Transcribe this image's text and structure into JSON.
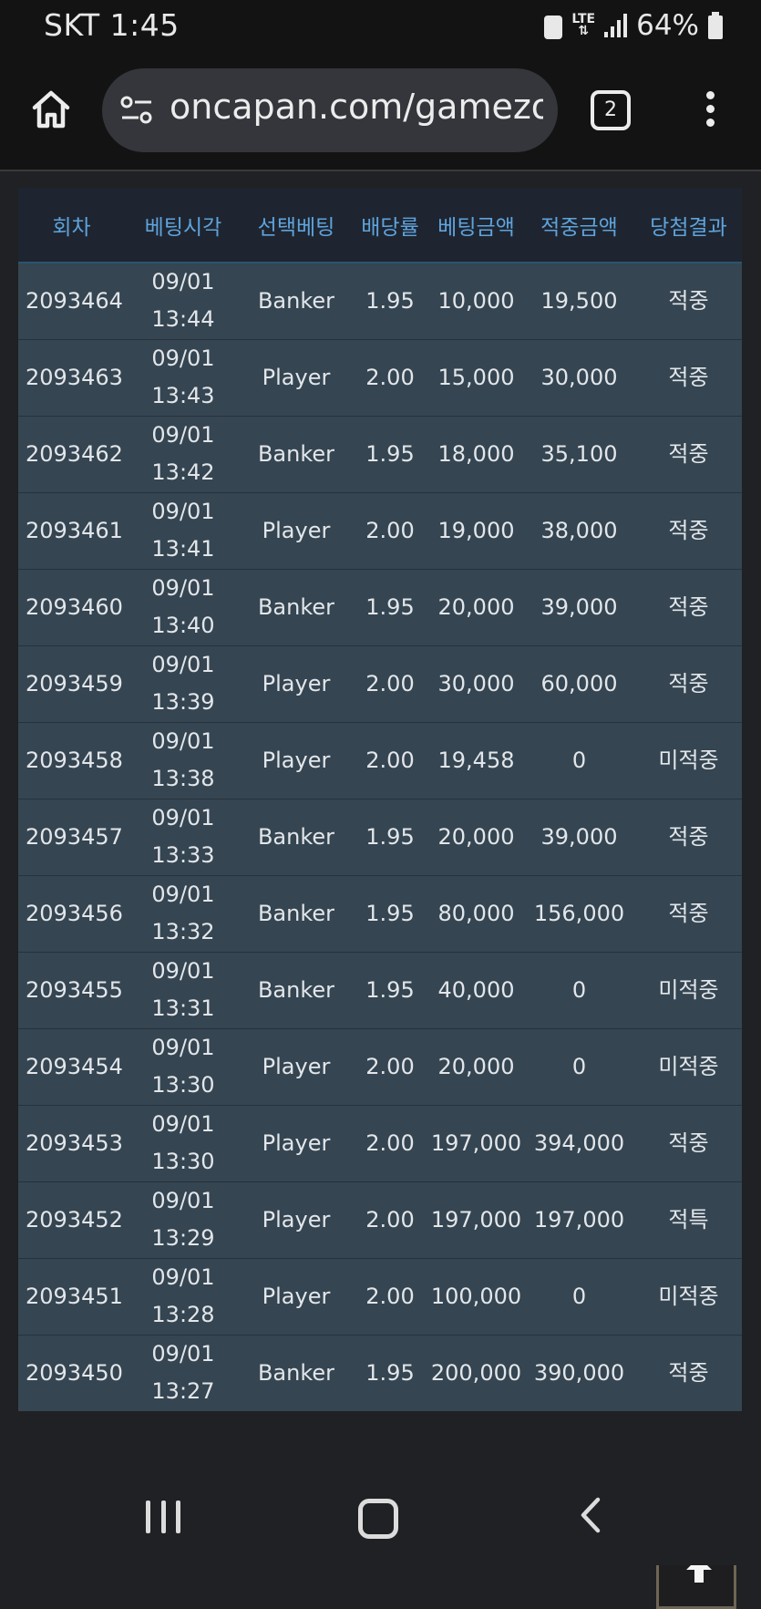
{
  "status_bar": {
    "carrier_time": "SKT 1:45",
    "network": "LTE",
    "battery": "64%"
  },
  "browser": {
    "url": "oncapan.com/gamezoi",
    "tab_count": "2"
  },
  "table": {
    "headers": [
      "회차",
      "베팅시각",
      "선택베팅",
      "배당률",
      "베팅금액",
      "적중금액",
      "당첨결과"
    ],
    "rows": [
      {
        "round": "2093464",
        "date": "09/01",
        "time": "13:44",
        "pick": "Banker",
        "odds": "1.95",
        "bet": "10,000",
        "payout": "19,500",
        "result": "적중"
      },
      {
        "round": "2093463",
        "date": "09/01",
        "time": "13:43",
        "pick": "Player",
        "odds": "2.00",
        "bet": "15,000",
        "payout": "30,000",
        "result": "적중"
      },
      {
        "round": "2093462",
        "date": "09/01",
        "time": "13:42",
        "pick": "Banker",
        "odds": "1.95",
        "bet": "18,000",
        "payout": "35,100",
        "result": "적중"
      },
      {
        "round": "2093461",
        "date": "09/01",
        "time": "13:41",
        "pick": "Player",
        "odds": "2.00",
        "bet": "19,000",
        "payout": "38,000",
        "result": "적중"
      },
      {
        "round": "2093460",
        "date": "09/01",
        "time": "13:40",
        "pick": "Banker",
        "odds": "1.95",
        "bet": "20,000",
        "payout": "39,000",
        "result": "적중"
      },
      {
        "round": "2093459",
        "date": "09/01",
        "time": "13:39",
        "pick": "Player",
        "odds": "2.00",
        "bet": "30,000",
        "payout": "60,000",
        "result": "적중"
      },
      {
        "round": "2093458",
        "date": "09/01",
        "time": "13:38",
        "pick": "Player",
        "odds": "2.00",
        "bet": "19,458",
        "payout": "0",
        "result": "미적중"
      },
      {
        "round": "2093457",
        "date": "09/01",
        "time": "13:33",
        "pick": "Banker",
        "odds": "1.95",
        "bet": "20,000",
        "payout": "39,000",
        "result": "적중"
      },
      {
        "round": "2093456",
        "date": "09/01",
        "time": "13:32",
        "pick": "Banker",
        "odds": "1.95",
        "bet": "80,000",
        "payout": "156,000",
        "result": "적중"
      },
      {
        "round": "2093455",
        "date": "09/01",
        "time": "13:31",
        "pick": "Banker",
        "odds": "1.95",
        "bet": "40,000",
        "payout": "0",
        "result": "미적중"
      },
      {
        "round": "2093454",
        "date": "09/01",
        "time": "13:30",
        "pick": "Player",
        "odds": "2.00",
        "bet": "20,000",
        "payout": "0",
        "result": "미적중"
      },
      {
        "round": "2093453",
        "date": "09/01",
        "time": "13:30",
        "pick": "Player",
        "odds": "2.00",
        "bet": "197,000",
        "payout": "394,000",
        "result": "적중"
      },
      {
        "round": "2093452",
        "date": "09/01",
        "time": "13:29",
        "pick": "Player",
        "odds": "2.00",
        "bet": "197,000",
        "payout": "197,000",
        "result": "적특"
      },
      {
        "round": "2093451",
        "date": "09/01",
        "time": "13:28",
        "pick": "Player",
        "odds": "2.00",
        "bet": "100,000",
        "payout": "0",
        "result": "미적중"
      },
      {
        "round": "2093450",
        "date": "09/01",
        "time": "13:27",
        "pick": "Banker",
        "odds": "1.95",
        "bet": "200,000",
        "payout": "390,000",
        "result": "적중"
      }
    ]
  },
  "colors": {
    "header_text": "#5fa3dc",
    "row_bg": "#354551",
    "win": "#f0a73c",
    "lose": "#f04848"
  },
  "icons": [
    "home-icon",
    "site-settings-icon",
    "tabs-icon",
    "more-menu-icon",
    "arrow-up-icon",
    "recent-apps-icon",
    "home-nav-icon",
    "back-icon"
  ]
}
